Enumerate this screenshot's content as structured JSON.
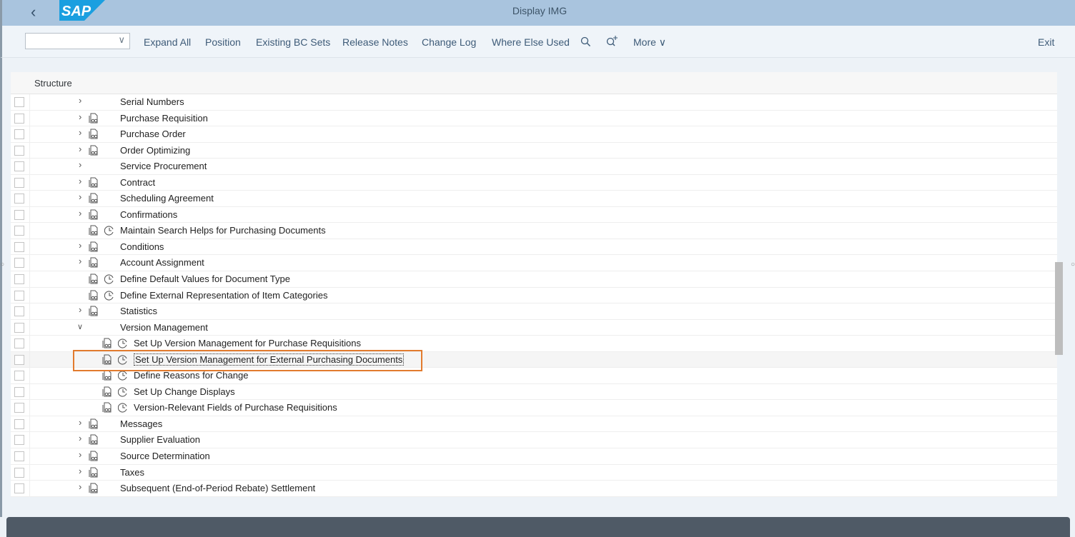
{
  "header": {
    "title": "Display IMG",
    "logo_text": "SAP",
    "brand_color": "#1a9fe0"
  },
  "toolbar": {
    "dropdown_value": "",
    "buttons": [
      "Expand All",
      "Position",
      "Existing BC Sets",
      "Release Notes",
      "Change Log",
      "Where Else Used"
    ],
    "more_label": "More",
    "exit_label": "Exit",
    "icons": [
      "search-icon",
      "search-next-icon"
    ]
  },
  "structure": {
    "header": "Structure",
    "highlight_color": "#e27b2e",
    "rows": [
      {
        "label": "Serial Numbers",
        "level": 0,
        "chevron": "right",
        "doc": false,
        "clock": false
      },
      {
        "label": "Purchase Requisition",
        "level": 0,
        "chevron": "right",
        "doc": true,
        "clock": false
      },
      {
        "label": "Purchase Order",
        "level": 0,
        "chevron": "right",
        "doc": true,
        "clock": false
      },
      {
        "label": "Order Optimizing",
        "level": 0,
        "chevron": "right",
        "doc": true,
        "clock": false
      },
      {
        "label": "Service Procurement",
        "level": 0,
        "chevron": "right",
        "doc": false,
        "clock": false
      },
      {
        "label": "Contract",
        "level": 0,
        "chevron": "right",
        "doc": true,
        "clock": false
      },
      {
        "label": "Scheduling Agreement",
        "level": 0,
        "chevron": "right",
        "doc": true,
        "clock": false
      },
      {
        "label": "Confirmations",
        "level": 0,
        "chevron": "right",
        "doc": true,
        "clock": false
      },
      {
        "label": "Maintain Search Helps for Purchasing Documents",
        "level": 0,
        "chevron": "",
        "doc": true,
        "clock": true
      },
      {
        "label": "Conditions",
        "level": 0,
        "chevron": "right",
        "doc": true,
        "clock": false
      },
      {
        "label": "Account Assignment",
        "level": 0,
        "chevron": "right",
        "doc": true,
        "clock": false
      },
      {
        "label": "Define Default Values for Document Type",
        "level": 0,
        "chevron": "",
        "doc": true,
        "clock": true
      },
      {
        "label": "Define External Representation of Item Categories",
        "level": 0,
        "chevron": "",
        "doc": true,
        "clock": true
      },
      {
        "label": "Statistics",
        "level": 0,
        "chevron": "right",
        "doc": true,
        "clock": false
      },
      {
        "label": "Version Management",
        "level": 0,
        "chevron": "down",
        "doc": false,
        "clock": false
      },
      {
        "label": "Set Up Version Management for Purchase Requisitions",
        "level": 1,
        "chevron": "",
        "doc": true,
        "clock": true
      },
      {
        "label": "Set Up Version Management for External Purchasing Documents",
        "level": 1,
        "chevron": "",
        "doc": true,
        "clock": true,
        "selected": true
      },
      {
        "label": "Define Reasons for Change",
        "level": 1,
        "chevron": "",
        "doc": true,
        "clock": true
      },
      {
        "label": "Set Up Change Displays",
        "level": 1,
        "chevron": "",
        "doc": true,
        "clock": true
      },
      {
        "label": "Version-Relevant Fields of Purchase Requisitions",
        "level": 1,
        "chevron": "",
        "doc": true,
        "clock": true
      },
      {
        "label": "Messages",
        "level": 0,
        "chevron": "right",
        "doc": true,
        "clock": false
      },
      {
        "label": "Supplier Evaluation",
        "level": 0,
        "chevron": "right",
        "doc": true,
        "clock": false
      },
      {
        "label": "Source Determination",
        "level": 0,
        "chevron": "right",
        "doc": true,
        "clock": false
      },
      {
        "label": "Taxes",
        "level": 0,
        "chevron": "right",
        "doc": true,
        "clock": false
      },
      {
        "label": "Subsequent (End-of-Period Rebate) Settlement",
        "level": 0,
        "chevron": "right",
        "doc": true,
        "clock": false
      }
    ]
  }
}
